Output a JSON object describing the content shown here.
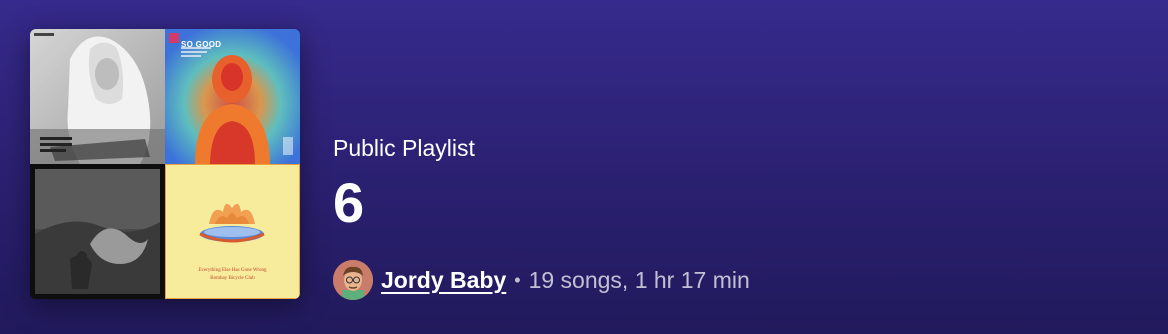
{
  "playlist": {
    "type_label": "Public Playlist",
    "title": "6",
    "owner_name": "Jordy Baby",
    "separator": "•",
    "stats": "19 songs, 1 hr 17 min"
  },
  "cover": {
    "tiles": [
      {
        "name": "cover-tile-1",
        "icon": "bw-photo-figure"
      },
      {
        "name": "cover-tile-2",
        "icon": "thermal-figure",
        "text": "SO GOOD"
      },
      {
        "name": "cover-tile-3",
        "icon": "bw-wave"
      },
      {
        "name": "cover-tile-4",
        "icon": "lotus-bowl",
        "text_line_1": "Everything Else Has Gone Wrong",
        "text_line_2": "Bombay Bicycle Club"
      }
    ]
  },
  "colors": {
    "background_top": "#362a8c",
    "background_bottom": "#211a5c",
    "text_primary": "#ffffff",
    "text_secondary": "rgba(255,255,255,0.72)"
  }
}
